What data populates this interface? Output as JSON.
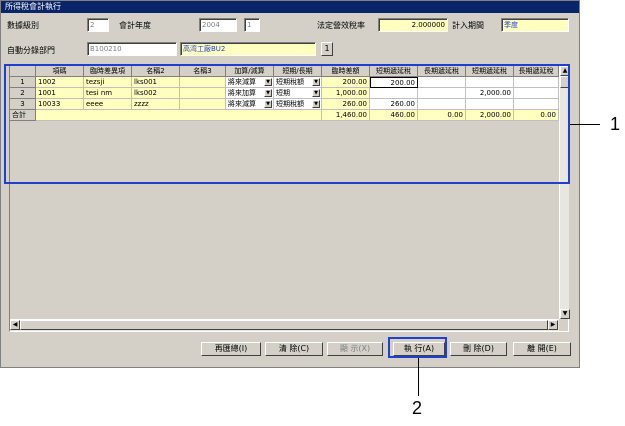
{
  "window": {
    "title": "所得稅會計執行"
  },
  "form": {
    "level_label": "數據級別",
    "level_value": "2",
    "year_label": "會計年度",
    "year_value": "2004",
    "month_value": "1",
    "rate_label": "法定營效稅率",
    "rate_value": "2.000000",
    "period_label": "計入期間",
    "period_value": "季度",
    "dept_label": "自動分錄部門",
    "dept_code": "B100210",
    "dept_name": "高湾工廠BU2",
    "dept_btn": "1"
  },
  "grid": {
    "columns": [
      "項碼",
      "臨時差異項",
      "名稱2",
      "名稱3",
      "加算/減算",
      "短期/長期",
      "臨時差額",
      "短期遞延稅",
      "長期遞延稅",
      "短期遞延稅",
      "長期遞延稅"
    ],
    "rows": [
      {
        "num": "1",
        "code": "1002",
        "item": "tezsji",
        "name2": "lks001",
        "name3": "",
        "addsub": "將來減算",
        "term": "短期稅額",
        "diff": "200.00",
        "st1": "200.00",
        "lt1": "",
        "st2": "",
        "lt2": ""
      },
      {
        "num": "2",
        "code": "1001",
        "item": "tesi nm",
        "name2": "lks002",
        "name3": "",
        "addsub": "將來加算",
        "term": "短期",
        "diff": "1,000.00",
        "st1": "",
        "lt1": "",
        "st2": "2,000.00",
        "lt2": ""
      },
      {
        "num": "3",
        "code": "10033",
        "item": "eeee",
        "name2": "zzzz",
        "name3": "",
        "addsub": "將來減算",
        "term": "短期稅額",
        "diff": "260.00",
        "st1": "260.00",
        "lt1": "",
        "st2": "",
        "lt2": ""
      }
    ],
    "total": {
      "label": "合計",
      "diff": "1,460.00",
      "st1": "460.00",
      "lt1": "0.00",
      "st2": "2,000.00",
      "lt2": "0.00"
    }
  },
  "buttons": {
    "recalc": "再匯總(I)",
    "clear": "清 除(C)",
    "show": "顯 示(X)",
    "execute": "執 行(A)",
    "delete": "刪 除(D)",
    "exit": "離 開(E)"
  },
  "callouts": {
    "one": "1",
    "two": "2"
  },
  "colors": {
    "callout": "#1f3fd0",
    "title_bar": "#0a246a",
    "highlight": "#ffffc0"
  }
}
